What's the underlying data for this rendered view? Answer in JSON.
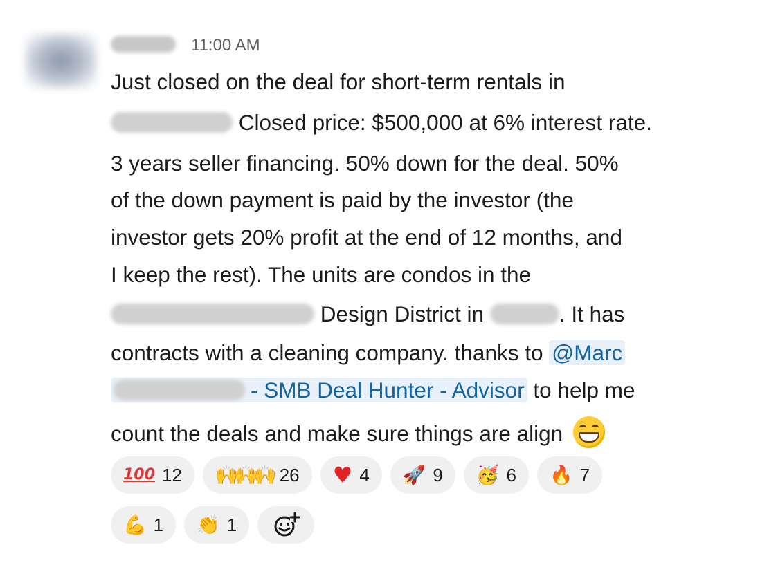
{
  "message": {
    "timestamp": "11:00 AM",
    "lines": {
      "l1": "Just closed on the deal for short-term rentals in",
      "l2": "Closed price: $500,000 at 6% interest rate.",
      "l3": "3 years seller financing. 50% down for the deal. 50%",
      "l4": "of the down payment is paid by the investor (the",
      "l5": "investor gets 20% profit at the end of 12 months, and",
      "l6": "I keep the rest). The units are condos in the",
      "l7a": "Design District in",
      "l7b": ". It has",
      "l8a": "contracts with a cleaning company. thanks to",
      "l8b": "@Marc",
      "l9a": "- SMB Deal Hunter - Advisor",
      "l9b": "to help me",
      "l10": "count the deals and make sure things are align"
    }
  },
  "reactions": [
    {
      "icon": "hundred-points-icon",
      "glyph": "100",
      "count": "12"
    },
    {
      "icon": "raising-hands-icon",
      "glyph": "🙌🙌🙌",
      "count": "26"
    },
    {
      "icon": "red-heart-icon",
      "glyph": "♥",
      "count": "4"
    },
    {
      "icon": "rocket-icon",
      "glyph": "🚀",
      "count": "9"
    },
    {
      "icon": "partying-face-icon",
      "glyph": "🥳",
      "count": "6"
    },
    {
      "icon": "fire-icon",
      "glyph": "🔥",
      "count": "7"
    },
    {
      "icon": "flexed-biceps-icon",
      "glyph": "💪",
      "count": "1"
    },
    {
      "icon": "clapping-hands-icon",
      "glyph": "👏",
      "count": "1"
    }
  ],
  "colors": {
    "text": "#1d1c1d",
    "timestamp": "#616061",
    "mention_text": "#1264a3",
    "mention_bg": "#e8f1f9",
    "pill_bg": "#f0f0f0"
  }
}
